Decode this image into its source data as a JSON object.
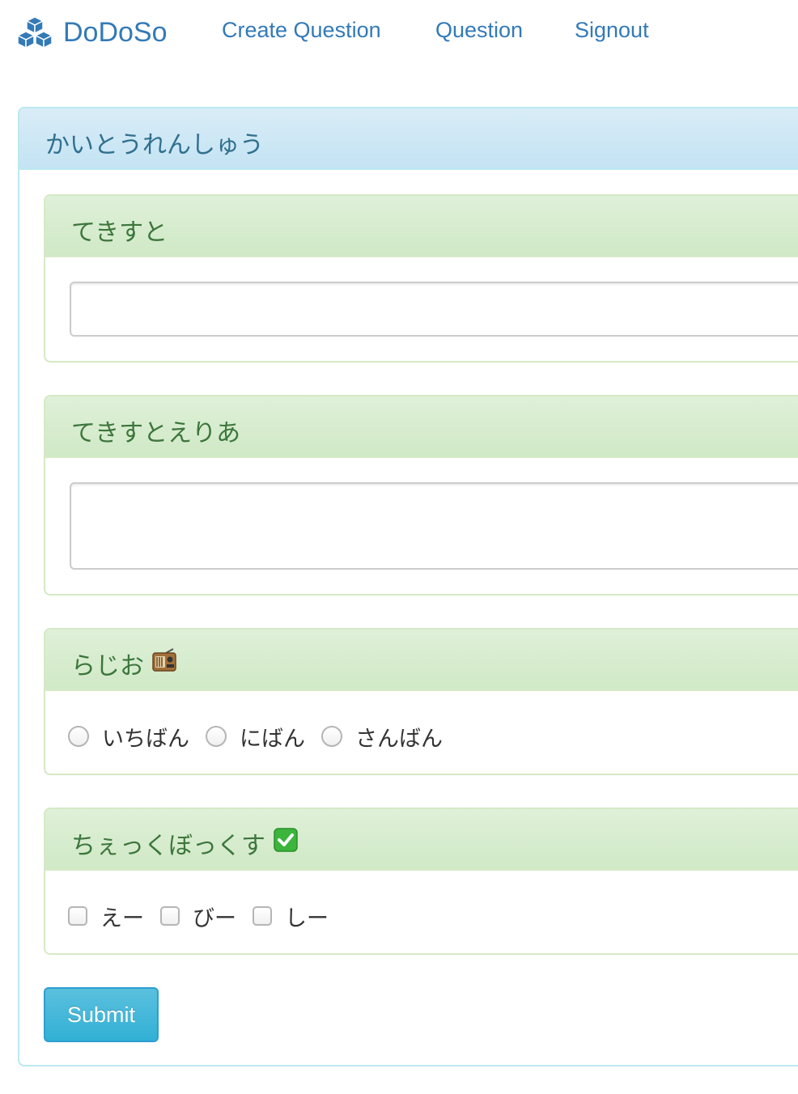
{
  "navbar": {
    "brand": "DoDoSo",
    "brand_icon": "cubes-icon",
    "links": [
      "Create Question",
      "Question",
      "Signout"
    ]
  },
  "form": {
    "title": "かいとうれんしゅう",
    "questions": [
      {
        "title": "てきすと",
        "type": "text",
        "value": ""
      },
      {
        "title": "てきすとえりあ",
        "type": "textarea",
        "value": ""
      },
      {
        "title": "らじお",
        "emoji": "📻",
        "type": "radio",
        "options": [
          "いちばん",
          "にばん",
          "さんばん"
        ]
      },
      {
        "title": "ちぇっくぼっくす",
        "emoji": "✅",
        "type": "checkbox",
        "options": [
          "えー",
          "びー",
          "しー"
        ]
      }
    ],
    "submit_label": "Submit"
  },
  "colors": {
    "link": "#337ab7",
    "info_heading": "#d9edf7",
    "success_heading": "#dff0d8",
    "submit_button": "#5bc0de"
  }
}
